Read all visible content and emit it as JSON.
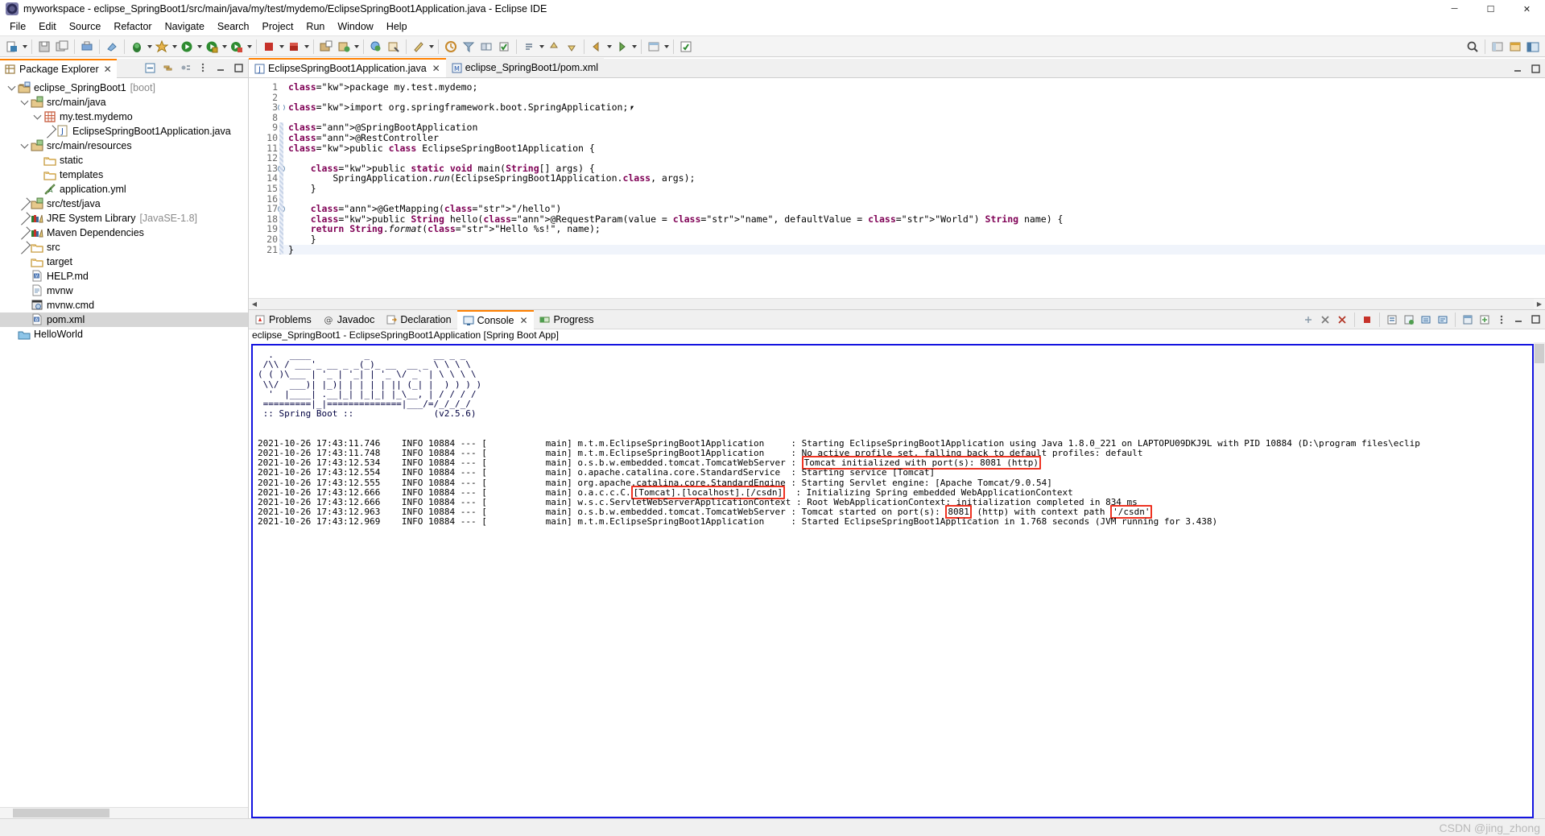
{
  "window": {
    "title": "myworkspace - eclipse_SpringBoot1/src/main/java/my/test/mydemo/EclipseSpringBoot1Application.java - Eclipse IDE",
    "minimize": "─",
    "maximize": "☐",
    "close": "✕"
  },
  "menubar": {
    "items": [
      "File",
      "Edit",
      "Source",
      "Refactor",
      "Navigate",
      "Search",
      "Project",
      "Run",
      "Window",
      "Help"
    ]
  },
  "explorer": {
    "tab_label": "Package Explorer",
    "close_label": "✕",
    "tree": [
      {
        "indent": 0,
        "twisty": "down",
        "icon": "project-icon",
        "label": "eclipse_SpringBoot1",
        "suffix": "[boot]"
      },
      {
        "indent": 1,
        "twisty": "down",
        "icon": "srcfolder-icon",
        "label": "src/main/java",
        "suffix": ""
      },
      {
        "indent": 2,
        "twisty": "down",
        "icon": "package-icon",
        "label": "my.test.mydemo",
        "suffix": ""
      },
      {
        "indent": 3,
        "twisty": "right",
        "icon": "java-icon",
        "label": "EclipseSpringBoot1Application.java",
        "suffix": ""
      },
      {
        "indent": 1,
        "twisty": "down",
        "icon": "srcfolder-icon",
        "label": "src/main/resources",
        "suffix": ""
      },
      {
        "indent": 2,
        "twisty": "none",
        "icon": "folder-icon",
        "label": "static",
        "suffix": ""
      },
      {
        "indent": 2,
        "twisty": "none",
        "icon": "folder-icon",
        "label": "templates",
        "suffix": ""
      },
      {
        "indent": 2,
        "twisty": "none",
        "icon": "yml-icon",
        "label": "application.yml",
        "suffix": ""
      },
      {
        "indent": 1,
        "twisty": "right",
        "icon": "srcfolder-icon",
        "label": "src/test/java",
        "suffix": ""
      },
      {
        "indent": 1,
        "twisty": "right",
        "icon": "library-icon",
        "label": "JRE System Library",
        "suffix": "[JavaSE-1.8]"
      },
      {
        "indent": 1,
        "twisty": "right",
        "icon": "library-icon",
        "label": "Maven Dependencies",
        "suffix": ""
      },
      {
        "indent": 1,
        "twisty": "right",
        "icon": "folder-icon",
        "label": "src",
        "suffix": ""
      },
      {
        "indent": 1,
        "twisty": "none",
        "icon": "folder-icon",
        "label": "target",
        "suffix": ""
      },
      {
        "indent": 1,
        "twisty": "none",
        "icon": "md-icon",
        "label": "HELP.md",
        "suffix": ""
      },
      {
        "indent": 1,
        "twisty": "none",
        "icon": "file-icon",
        "label": "mvnw",
        "suffix": ""
      },
      {
        "indent": 1,
        "twisty": "none",
        "icon": "cmd-icon",
        "label": "mvnw.cmd",
        "suffix": ""
      },
      {
        "indent": 1,
        "twisty": "none",
        "icon": "pom-icon",
        "label": "pom.xml",
        "suffix": "",
        "selected": true
      },
      {
        "indent": 0,
        "twisty": "none",
        "icon": "project-closed-icon",
        "label": "HelloWorld",
        "suffix": ""
      }
    ]
  },
  "editor": {
    "tabs": [
      {
        "label": "EclipseSpringBoot1Application.java",
        "icon": "java-icon",
        "active": true,
        "close": "✕"
      },
      {
        "label": "eclipse_SpringBoot1/pom.xml",
        "icon": "pom-icon",
        "active": false,
        "close": ""
      }
    ],
    "lines": [
      {
        "num": "1",
        "fold": "",
        "marked": false,
        "text": "package my.test.mydemo;"
      },
      {
        "num": "2",
        "fold": "",
        "marked": false,
        "text": ""
      },
      {
        "num": "3",
        "fold": "+",
        "marked": false,
        "text": "import org.springframework.boot.SpringApplication;⎖"
      },
      {
        "num": "8",
        "fold": "",
        "marked": false,
        "text": ""
      },
      {
        "num": "9",
        "fold": "",
        "marked": true,
        "text": "@SpringBootApplication"
      },
      {
        "num": "10",
        "fold": "",
        "marked": true,
        "text": "@RestController"
      },
      {
        "num": "11",
        "fold": "",
        "marked": true,
        "text": "public class EclipseSpringBoot1Application {"
      },
      {
        "num": "12",
        "fold": "",
        "marked": true,
        "text": ""
      },
      {
        "num": "13",
        "fold": "-",
        "marked": true,
        "text": "    public static void main(String[] args) {"
      },
      {
        "num": "14",
        "fold": "",
        "marked": true,
        "text": "        SpringApplication.run(EclipseSpringBoot1Application.class, args);"
      },
      {
        "num": "15",
        "fold": "",
        "marked": true,
        "text": "    }"
      },
      {
        "num": "16",
        "fold": "",
        "marked": true,
        "text": ""
      },
      {
        "num": "17",
        "fold": "-",
        "marked": true,
        "text": "    @GetMapping(\"/hello\")"
      },
      {
        "num": "18",
        "fold": "",
        "marked": true,
        "text": "    public String hello(@RequestParam(value = \"name\", defaultValue = \"World\") String name) {"
      },
      {
        "num": "19",
        "fold": "",
        "marked": true,
        "text": "    return String.format(\"Hello %s!\", name);"
      },
      {
        "num": "20",
        "fold": "",
        "marked": true,
        "text": "    }"
      },
      {
        "num": "21",
        "fold": "",
        "marked": true,
        "text": "}"
      }
    ]
  },
  "console": {
    "tabs": [
      {
        "label": "Problems",
        "icon": "problems-icon",
        "active": false,
        "close": ""
      },
      {
        "label": "Javadoc",
        "icon": "javadoc-icon",
        "active": false,
        "close": ""
      },
      {
        "label": "Declaration",
        "icon": "declaration-icon",
        "active": false,
        "close": ""
      },
      {
        "label": "Console",
        "icon": "console-icon",
        "active": true,
        "close": "✕"
      },
      {
        "label": "Progress",
        "icon": "progress-icon",
        "active": false,
        "close": ""
      }
    ],
    "launch_title": "eclipse_SpringBoot1 - EclipseSpringBoot1Application [Spring Boot App]",
    "banner": [
      "  .   ____          _            __ _ _",
      " /\\\\ / ___'_ __ _ _(_)_ __  __ _ \\ \\ \\ \\",
      "( ( )\\___ | '_ | '_| | '_ \\/ _` | \\ \\ \\ \\",
      " \\\\/  ___)| |_)| | | | | || (_| |  ) ) ) )",
      "  '  |____| .__|_| |_|_| |_\\__, | / / / /",
      " =========|_|==============|___/=/_/_/_/"
    ],
    "banner_footer_left": " :: Spring Boot :: ",
    "banner_footer_right": "(v2.5.6)",
    "log": [
      {
        "ts": "2021-10-26 17:43:11.746",
        "level": "INFO",
        "pid": "10884",
        "dashes": "---",
        "thread": "main",
        "logger": "m.t.m.EclipseSpringBoot1Application",
        "msg_pre": "Starting EclipseSpringBoot1Application using Java 1.8.0_221 on LAPTOPU09DKJ9L with PID 10884 (D:\\program files\\eclip",
        "hl": "",
        "msg_post": ""
      },
      {
        "ts": "2021-10-26 17:43:11.748",
        "level": "INFO",
        "pid": "10884",
        "dashes": "---",
        "thread": "main",
        "logger": "m.t.m.EclipseSpringBoot1Application",
        "msg_pre": "No active profile set, falling back to default profiles: default",
        "hl": "",
        "msg_post": ""
      },
      {
        "ts": "2021-10-26 17:43:12.534",
        "level": "INFO",
        "pid": "10884",
        "dashes": "---",
        "thread": "main",
        "logger": "o.s.b.w.embedded.tomcat.TomcatWebServer",
        "msg_pre": "",
        "hl": "Tomcat initialized with port(s): 8081 (http)",
        "msg_post": ""
      },
      {
        "ts": "2021-10-26 17:43:12.554",
        "level": "INFO",
        "pid": "10884",
        "dashes": "---",
        "thread": "main",
        "logger": "o.apache.catalina.core.StandardService",
        "msg_pre": "Starting service [Tomcat]",
        "hl": "",
        "msg_post": ""
      },
      {
        "ts": "2021-10-26 17:43:12.555",
        "level": "INFO",
        "pid": "10884",
        "dashes": "---",
        "thread": "main",
        "logger": "org.apache.catalina.core.StandardEngine",
        "msg_pre": "Starting Servlet engine: [Apache Tomcat/9.0.54]",
        "hl": "",
        "msg_post": ""
      },
      {
        "ts": "2021-10-26 17:43:12.666",
        "level": "INFO",
        "pid": "10884",
        "dashes": "---",
        "thread": "main",
        "logger_pre": "o.a.c.c.C.",
        "logger_hl": "[Tomcat].[localhost].[/csdn]",
        "logger": "",
        "msg_pre": "Initializing Spring embedded WebApplicationContext",
        "hl": "",
        "msg_post": ""
      },
      {
        "ts": "2021-10-26 17:43:12.666",
        "level": "INFO",
        "pid": "10884",
        "dashes": "---",
        "thread": "main",
        "logger": "w.s.c.ServletWebServerApplicationContext",
        "msg_pre": "Root WebApplicationContext: initialization completed in 834 ms",
        "hl": "",
        "msg_post": ""
      },
      {
        "ts": "2021-10-26 17:43:12.963",
        "level": "INFO",
        "pid": "10884",
        "dashes": "---",
        "thread": "main",
        "logger": "o.s.b.w.embedded.tomcat.TomcatWebServer",
        "msg_pre": "Tomcat started on port(s): ",
        "hl": "8081",
        "msg_mid": " (http) with context path ",
        "hl2": "'/csdn'",
        "msg_post": ""
      },
      {
        "ts": "2021-10-26 17:43:12.969",
        "level": "INFO",
        "pid": "10884",
        "dashes": "---",
        "thread": "main",
        "logger": "m.t.m.EclipseSpringBoot1Application",
        "msg_pre": "Started EclipseSpringBoot1Application in 1.768 seconds (JVM running for 3.438)",
        "hl": "",
        "msg_post": ""
      }
    ]
  },
  "statusbar": {
    "watermark": "CSDN @jing_zhong"
  },
  "colors": {
    "accent_tab": "#ff8000",
    "console_border": "#1414e0",
    "highlight_border": "#ee3322",
    "keyword": "#7f0055",
    "string": "#2a00ff"
  }
}
